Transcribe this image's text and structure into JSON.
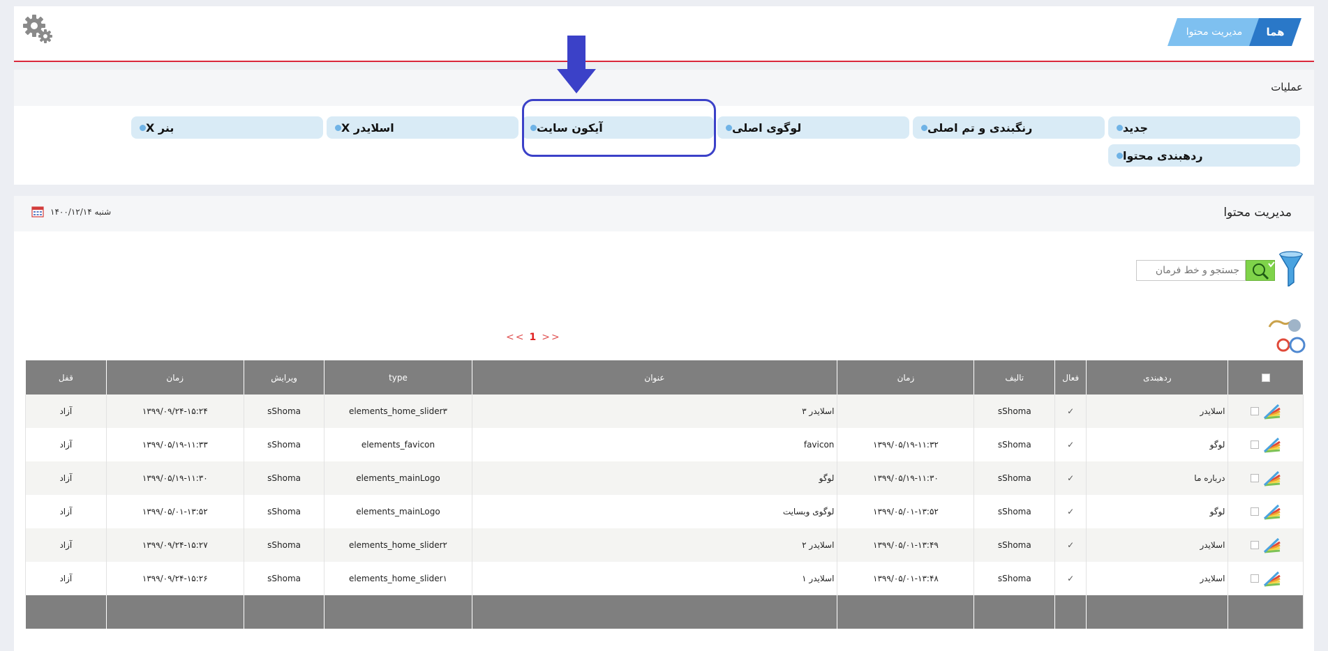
{
  "breadcrumb": {
    "home": "هما",
    "current": "مدیریت محتوا"
  },
  "operations": {
    "title": "عملیات",
    "buttons": [
      {
        "label": "جدید"
      },
      {
        "label": "رنگبندی و تم اصلی"
      },
      {
        "label": "لوگوی اصلی"
      },
      {
        "label": "آیکون سایت"
      },
      {
        "label": "اسلایدر X"
      },
      {
        "label": "بنر X"
      },
      {
        "label": "ردهبندی محتوا"
      }
    ]
  },
  "content": {
    "title": "مدیریت محتوا",
    "date": "شنبه ۱۴۰۰/۱۲/۱۴",
    "search_placeholder": "جستجو و خط فرمان",
    "pager": {
      "prev": "<<",
      "page": "1",
      "next": ">>"
    }
  },
  "table": {
    "headers": [
      "ردهبندی",
      "فعال",
      "تالیف",
      "زمان",
      "عنوان",
      "type",
      "ویرایش",
      "زمان",
      "قفل"
    ],
    "rows": [
      [
        "اسلایدر",
        "✓",
        "sShoma",
        "",
        "اسلایدر ۳",
        "elements_home_slider۳",
        "sShoma",
        "۱۳۹۹/۰۹/۲۴-۱۵:۲۴",
        "آزاد"
      ],
      [
        "لوگو",
        "✓",
        "sShoma",
        "۱۳۹۹/۰۵/۱۹-۱۱:۳۲",
        "favicon",
        "elements_favicon",
        "sShoma",
        "۱۳۹۹/۰۵/۱۹-۱۱:۳۳",
        "آزاد"
      ],
      [
        "درباره ما",
        "✓",
        "sShoma",
        "۱۳۹۹/۰۵/۱۹-۱۱:۳۰",
        "لوگو",
        "elements_mainLogo",
        "sShoma",
        "۱۳۹۹/۰۵/۱۹-۱۱:۳۰",
        "آزاد"
      ],
      [
        "لوگو",
        "✓",
        "sShoma",
        "۱۳۹۹/۰۵/۰۱-۱۳:۵۲",
        "لوگوی وبسایت",
        "elements_mainLogo",
        "sShoma",
        "۱۳۹۹/۰۵/۰۱-۱۳:۵۲",
        "آزاد"
      ],
      [
        "اسلایدر",
        "✓",
        "sShoma",
        "۱۳۹۹/۰۵/۰۱-۱۳:۴۹",
        "اسلایدر ۲",
        "elements_home_slider۲",
        "sShoma",
        "۱۳۹۹/۰۹/۲۴-۱۵:۲۷",
        "آزاد"
      ],
      [
        "اسلایدر",
        "✓",
        "sShoma",
        "۱۳۹۹/۰۵/۰۱-۱۳:۴۸",
        "اسلایدر ۱",
        "elements_home_slider۱",
        "sShoma",
        "۱۳۹۹/۰۹/۲۴-۱۵:۲۶",
        "آزاد"
      ]
    ]
  },
  "icons": {
    "settings": "gears-icon",
    "calendar": "calendar-icon",
    "filter": "funnel-icon",
    "search": "search-icon",
    "refresh": "refresh-icon",
    "row_type": "color-fan-icon"
  },
  "colors": {
    "accent_red": "#d9263a",
    "breadcrumb_home": "#2a78c8",
    "breadcrumb_current": "#7ec0f0",
    "op_button": "#d9ebf6",
    "highlight": "#3b41c8",
    "table_header": "#7f7f7f",
    "search_button": "#7fd34a"
  }
}
